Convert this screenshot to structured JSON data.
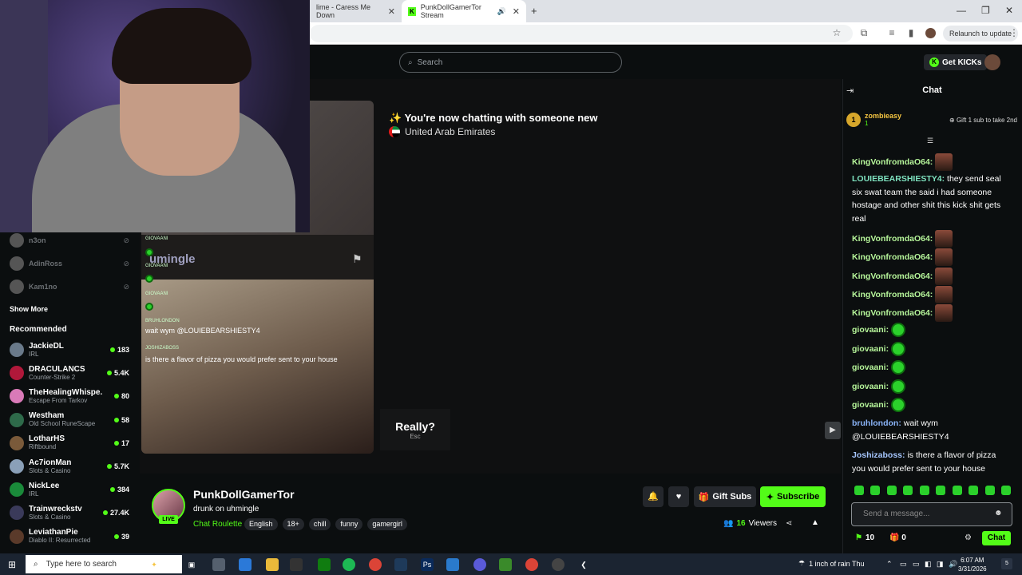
{
  "browser": {
    "tabs": [
      {
        "label": "lime - Caress Me Down"
      },
      {
        "label": "PunkDollGamerTor Stream"
      }
    ],
    "relaunch_label": "Relaunch to update"
  },
  "header": {
    "search_placeholder": "Search",
    "get_kicks_label": "Get KICKs"
  },
  "sidebar": {
    "followed": [
      {
        "name": "n3on",
        "status": "offline"
      },
      {
        "name": "AdinRoss",
        "status": "offline"
      },
      {
        "name": "Kam1no",
        "status": "offline"
      }
    ],
    "show_more_label": "Show More",
    "recommended_label": "Recommended",
    "recommended": [
      {
        "name": "JackieDL",
        "category": "IRL",
        "viewers": "183",
        "avatar_color": "#6a7a8a"
      },
      {
        "name": "DRACULANCS",
        "category": "Counter-Strike 2",
        "viewers": "5.4K",
        "avatar_color": "#b0183a"
      },
      {
        "name": "TheHealingWhispe...",
        "category": "Escape From Tarkov",
        "viewers": "80",
        "avatar_color": "#d97ab8"
      },
      {
        "name": "Westham",
        "category": "Old School RuneScape",
        "viewers": "58",
        "avatar_color": "#2e6a4a"
      },
      {
        "name": "LotharHS",
        "category": "Riftbound",
        "viewers": "17",
        "avatar_color": "#7a5a3a"
      },
      {
        "name": "Ac7ionMan",
        "category": "Slots & Casino",
        "viewers": "5.7K",
        "avatar_color": "#8aa0b8"
      },
      {
        "name": "NickLee",
        "category": "IRL",
        "viewers": "384",
        "avatar_color": "#1a8a3a"
      },
      {
        "name": "Trainwreckstv",
        "category": "Slots & Casino",
        "viewers": "27.4K",
        "avatar_color": "#3a3a5a"
      },
      {
        "name": "LeviathanPie",
        "category": "Diablo II: Resurrected",
        "viewers": "39",
        "avatar_color": "#5a3a2a"
      }
    ]
  },
  "video": {
    "new_chat_title": "✨ You're now chatting with someone new",
    "country": "United Arab Emirates",
    "overlay_brand": "umingle",
    "overlay_messages": [
      {
        "user": "GIOVAANI",
        "text": ""
      },
      {
        "user": "GIOVAANI",
        "text": ""
      },
      {
        "user": "GIOVAANI",
        "text": ""
      },
      {
        "user": "BRUHLONDON",
        "text": "wait wym @LOUIEBEARSHIESTY4"
      },
      {
        "user": "JOSHIZABOSS",
        "text": "is there a flavor of pizza you would prefer sent to your house"
      }
    ],
    "really_label": "Really?",
    "really_sub": "Esc"
  },
  "stream": {
    "streamer": "PunkDollGamerTor",
    "title": "drunk on uhmingle",
    "category": "Chat Roulette",
    "tags": [
      "English",
      "18+",
      "chill",
      "funny",
      "gamergirl"
    ],
    "live_label": "LIVE",
    "gift_subs_label": "Gift Subs",
    "subscribe_label": "Subscribe",
    "viewers_count": "16",
    "viewers_label": "Viewers"
  },
  "chat": {
    "title": "Chat",
    "pinned": {
      "rank": "1",
      "user": "zombieasy",
      "count": "1",
      "promo": "Gift 1 sub to take 2nd"
    },
    "messages": [
      {
        "user": "KingVonfromdaO64:",
        "text": "",
        "color": "#b6f59a",
        "emote": "face"
      },
      {
        "user": "LOUIEBEARSHIESTY4:",
        "text": "they send seal six swat team the said i had someone hostage and other shit this kick shit gets real",
        "color": "#7fe3c0",
        "emote": ""
      },
      {
        "user": "KingVonfromdaO64:",
        "text": "",
        "color": "#b6f59a",
        "emote": "face"
      },
      {
        "user": "KingVonfromdaO64:",
        "text": "",
        "color": "#b6f59a",
        "emote": "face"
      },
      {
        "user": "KingVonfromdaO64:",
        "text": "",
        "color": "#b6f59a",
        "emote": "face"
      },
      {
        "user": "KingVonfromdaO64:",
        "text": "",
        "color": "#b6f59a",
        "emote": "face"
      },
      {
        "user": "KingVonfromdaO64:",
        "text": "",
        "color": "#b6f59a",
        "emote": "face"
      },
      {
        "user": "giovaani:",
        "text": "",
        "color": "#b6f59a",
        "emote": "green"
      },
      {
        "user": "giovaani:",
        "text": "",
        "color": "#b6f59a",
        "emote": "green"
      },
      {
        "user": "giovaani:",
        "text": "",
        "color": "#b6f59a",
        "emote": "green"
      },
      {
        "user": "giovaani:",
        "text": "",
        "color": "#b6f59a",
        "emote": "green"
      },
      {
        "user": "giovaani:",
        "text": "",
        "color": "#b6f59a",
        "emote": "green"
      },
      {
        "user": "bruhlondon:",
        "text": "wait wym @LOUIEBEARSHIESTY4",
        "color": "#8ab4f8",
        "emote": ""
      },
      {
        "user": "Joshizaboss:",
        "text": "is there a flavor of pizza you would prefer sent to your house",
        "color": "#a7c7ff",
        "emote": ""
      }
    ],
    "input_placeholder": "Send a message...",
    "kicks_count": "10",
    "gifts_count": "0",
    "chat_button_label": "Chat"
  },
  "taskbar": {
    "search_placeholder": "Type here to search",
    "weather": "1 inch of rain Thu",
    "time": "6:07 AM",
    "date": "3/31/2026",
    "notification_count": "5"
  },
  "colors": {
    "accent": "#53fc18",
    "background": "#0b0e0f",
    "panel": "#24272c"
  }
}
